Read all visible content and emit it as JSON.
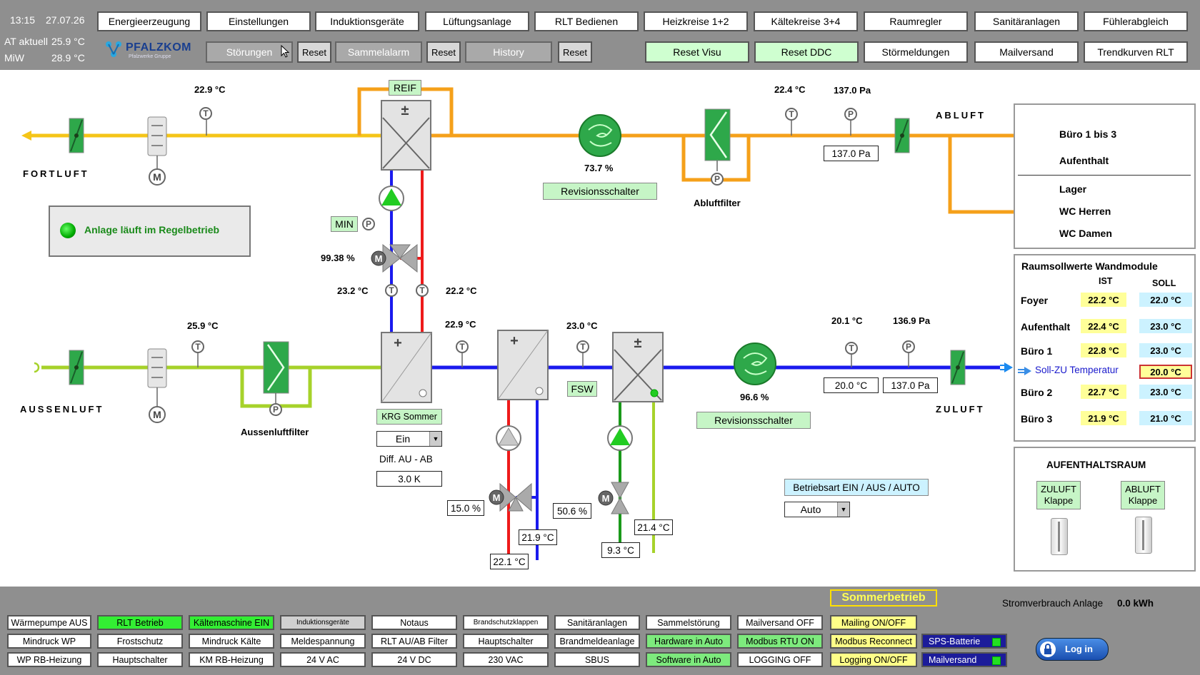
{
  "header": {
    "time": "13:15",
    "date": "27.07.26",
    "at_label": "AT aktuell",
    "at_value": "25.9 °C",
    "miw_label": "MiW",
    "miw_value": "28.9 °C",
    "logo_text": "PFALZKOM",
    "logo_sub": "Pfalzwerke Gruppe"
  },
  "nav": {
    "row1": [
      "Energieerzeugung",
      "Einstellungen",
      "Induktionsgeräte",
      "Lüftungsanlage",
      "RLT Bedienen",
      "Heizkreise 1+2",
      "Kältekreise 3+4",
      "Raumregler",
      "Sanitäranlagen",
      "Fühlerabgleich"
    ],
    "stoerungen": "Störungen",
    "sammelalarm": "Sammelalarm",
    "history": "History",
    "reset": "Reset",
    "reset_visu": "Reset Visu",
    "reset_ddc": "Reset DDC",
    "stoermeldungen": "Störmeldungen",
    "mailversand": "Mailversand",
    "trendkurven": "Trendkurven RLT"
  },
  "status": {
    "text": "Anlage läuft im Regelbetrieb",
    "color": "#1a8a1a"
  },
  "plant": {
    "fortluft": "FORTLUFT",
    "abluft": "ABLUFT",
    "aussenluft": "AUSSENLUFT",
    "zuluft": "ZULUFT",
    "t_fortluft": "22.9 °C",
    "reif": "REIF",
    "fan_exhaust_pct": "73.7 %",
    "revisionsschalter": "Revisionsschalter",
    "abluftfilter": "Abluftfilter",
    "t_abluft": "22.4 °C",
    "p_abluft": "137.0 Pa",
    "p_abluft_box": "137.0 Pa",
    "min": "MIN",
    "valve_krg_pct": "99.38 %",
    "t_krg_vl": "23.2 °C",
    "t_krg_rl": "22.2 °C",
    "t_aussen": "25.9 °C",
    "t_after_krg": "22.9 °C",
    "t_after_heat": "23.0 °C",
    "fsw": "FSW",
    "aussenluftfilter": "Aussenluftfilter",
    "krg_sommer": "KRG Sommer",
    "krg_mode": "Ein",
    "diff_label": "Diff. AU - AB",
    "diff_value": "3.0 K",
    "valve_heat_pct": "15.0 %",
    "t_heat_rl": "21.9 °C",
    "t_heat_vl": "22.1 °C",
    "valve_cool_pct": "50.6 %",
    "t_cool_rl": "21.4 °C",
    "t_cool_vl": "9.3 °C",
    "fan_supply_pct": "96.6 %",
    "revisionsschalter2": "Revisionsschalter",
    "t_zuluft": "20.1 °C",
    "p_zuluft": "136.9 Pa",
    "t_zuluft_box": "20.0 °C",
    "p_zuluft_box": "137.0 Pa",
    "betriebsart_label": "Betriebsart EIN / AUS / AUTO",
    "betriebsart_value": "Auto"
  },
  "rooms": {
    "group1": [
      "Büro 1 bis 3",
      "Aufenthalt"
    ],
    "group2": [
      "Lager",
      "WC Herren",
      "WC Damen"
    ]
  },
  "setpoints": {
    "title": "Raumsollwerte Wandmodule",
    "ist_header": "IST",
    "soll_header": "SOLL",
    "rows": [
      {
        "name": "Foyer",
        "ist": "22.2 °C",
        "soll": "22.0 °C"
      },
      {
        "name": "Aufenthalt",
        "ist": "22.4 °C",
        "soll": "23.0 °C"
      },
      {
        "name": "Büro 1",
        "ist": "22.8 °C",
        "soll": "23.0 °C"
      },
      {
        "name": "Büro 2",
        "ist": "22.7 °C",
        "soll": "23.0 °C"
      },
      {
        "name": "Büro 3",
        "ist": "21.9 °C",
        "soll": "21.0 °C"
      }
    ],
    "soll_zu_label": "Soll-ZU Temperatur",
    "soll_zu_value": "20.0 °C"
  },
  "aufenthaltsraum": {
    "title": "AUFENTHALTSRAUM",
    "zuluft_klappe": [
      "ZULUFT",
      "Klappe"
    ],
    "abluft_klappe": [
      "ABLUFT",
      "Klappe"
    ]
  },
  "footer": {
    "sommerbetrieb": "Sommerbetrieb",
    "strom_label": "Stromverbrauch Anlage",
    "strom_value": "0.0 kWh",
    "login": "Log in",
    "row1": [
      "Wärmepumpe AUS",
      "RLT Betrieb",
      "Kältemaschine EIN",
      "Induktionsgeräte",
      "Notaus",
      "Brandschutzklappen",
      "Sanitäranlagen",
      "Sammelstörung",
      "Mailversand OFF",
      "Mailing ON/OFF"
    ],
    "row2": [
      "Mindruck WP",
      "Frostschutz",
      "Mindruck Kälte",
      "Meldespannung",
      "RLT AU/AB Filter",
      "Hauptschalter",
      "Brandmeldeanlage",
      "Hardware in Auto",
      "Modbus RTU ON",
      "Modbus Reconnect",
      "SPS-Batterie"
    ],
    "row3": [
      "WP RB-Heizung",
      "Hauptschalter",
      "KM RB-Heizung",
      "24 V AC",
      "24 V DC",
      "230 VAC",
      "SBUS",
      "Software in Auto",
      "LOGGING OFF",
      "Logging ON/OFF",
      "Mailversand"
    ]
  },
  "colors": {
    "pipe_exhaust_yellow": "#f5c518",
    "pipe_exhaust_orange": "#f5a01a",
    "pipe_outdoor_green": "#a6d22a",
    "pipe_supply_blue": "#1a1aee",
    "pipe_hot_red": "#ee1a1a",
    "pipe_cool_green": "#1a991a",
    "led_green": "#22dd22"
  }
}
